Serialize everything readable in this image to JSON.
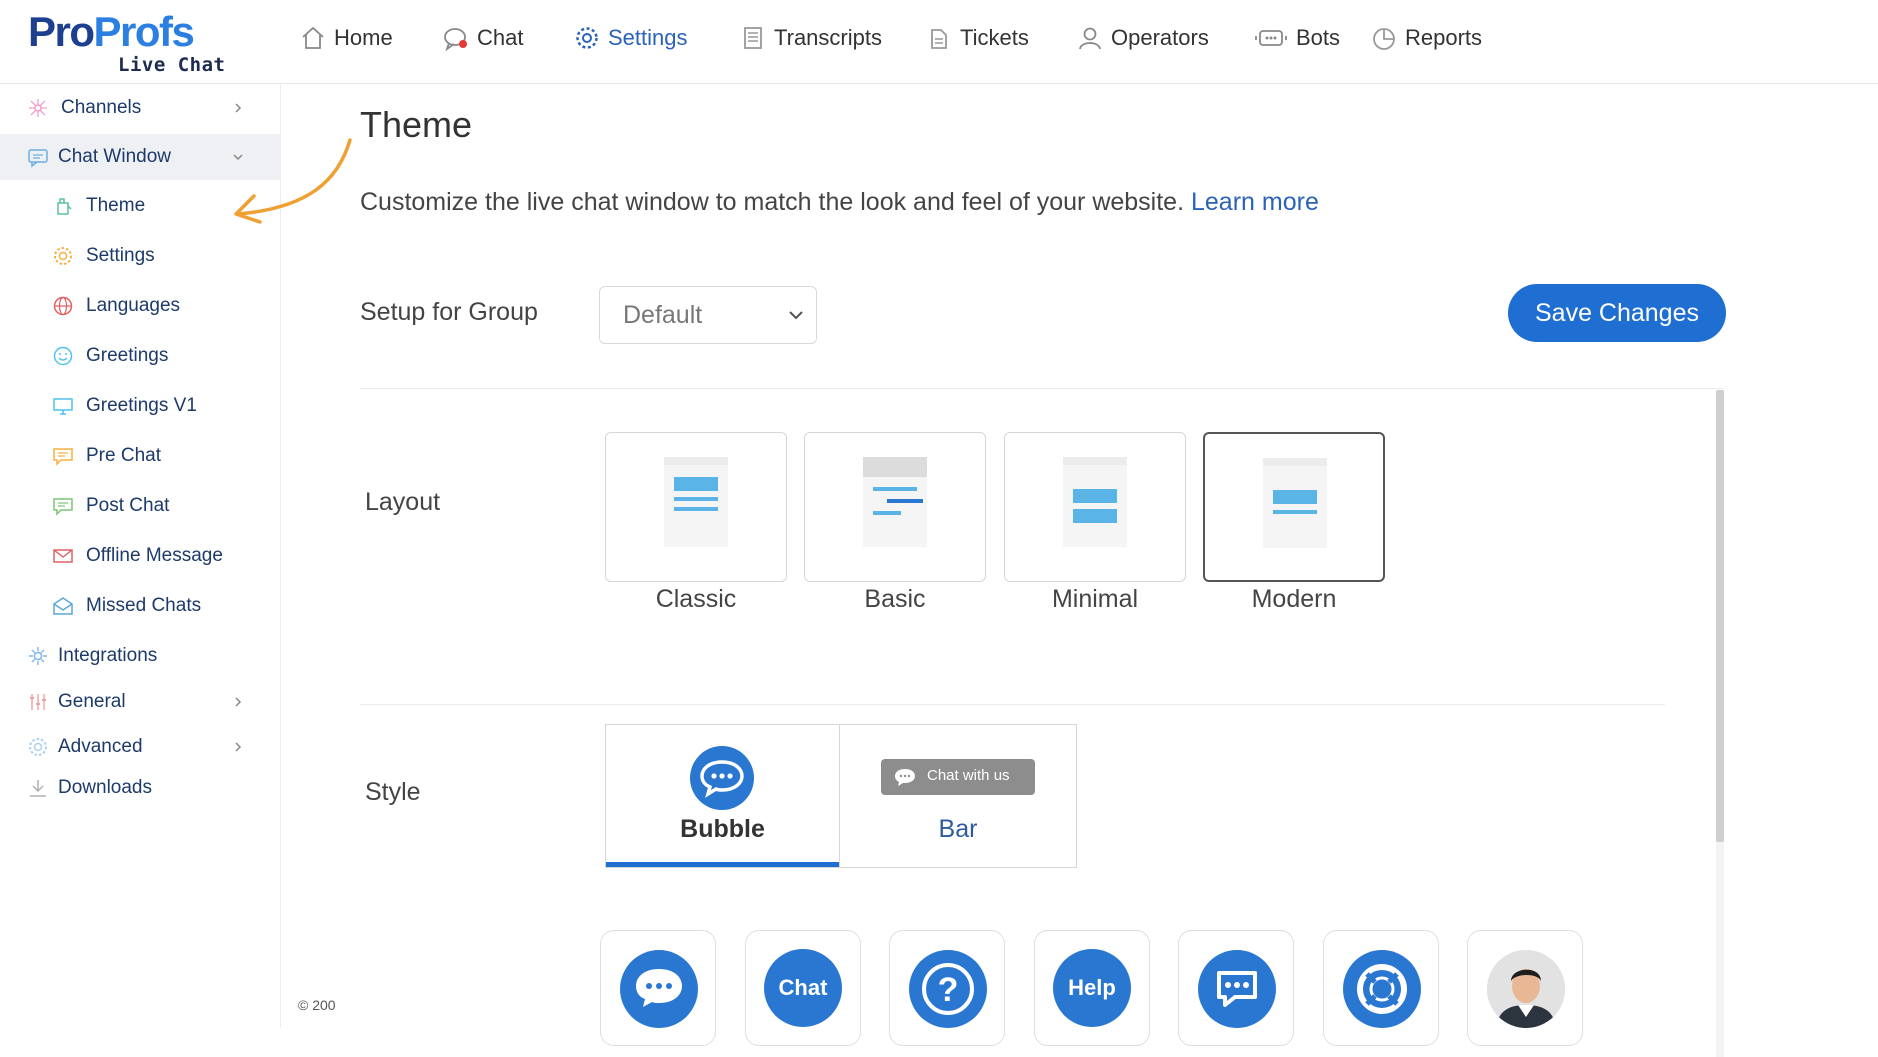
{
  "brand": {
    "name_part1": "Pro",
    "name_part2": "Profs",
    "product": "Live Chat"
  },
  "nav": [
    {
      "label": "Home",
      "icon": "home-icon"
    },
    {
      "label": "Chat",
      "icon": "chat-icon"
    },
    {
      "label": "Settings",
      "icon": "gear-icon"
    },
    {
      "label": "Transcripts",
      "icon": "document-icon"
    },
    {
      "label": "Tickets",
      "icon": "ticket-icon"
    },
    {
      "label": "Operators",
      "icon": "user-icon"
    },
    {
      "label": "Bots",
      "icon": "bot-icon"
    },
    {
      "label": "Reports",
      "icon": "pie-chart-icon"
    }
  ],
  "sidebar": {
    "items": [
      {
        "label": "Channels",
        "icon": "network-icon",
        "has_chevron": true
      },
      {
        "label": "Chat Window",
        "icon": "chat-window-icon",
        "has_chevron": true,
        "expanded": true
      },
      {
        "label": "Theme",
        "icon": "paint-bucket-icon"
      },
      {
        "label": "Settings",
        "icon": "gear-icon"
      },
      {
        "label": "Languages",
        "icon": "globe-icon"
      },
      {
        "label": "Greetings",
        "icon": "smiley-icon"
      },
      {
        "label": "Greetings V1",
        "icon": "monitor-icon"
      },
      {
        "label": "Pre Chat",
        "icon": "chat-bubble-icon"
      },
      {
        "label": "Post Chat",
        "icon": "chat-bubble-icon"
      },
      {
        "label": "Offline Message",
        "icon": "envelope-icon"
      },
      {
        "label": "Missed Chats",
        "icon": "open-envelope-icon"
      },
      {
        "label": "Integrations",
        "icon": "puzzle-icon"
      },
      {
        "label": "General",
        "icon": "sliders-icon",
        "has_chevron": true
      },
      {
        "label": "Advanced",
        "icon": "gear-icon",
        "has_chevron": true
      },
      {
        "label": "Downloads",
        "icon": "download-icon"
      }
    ],
    "copyright": "© 200"
  },
  "main": {
    "title": "Theme",
    "description": "Customize the live chat window to match the look and feel of your website.",
    "learn_more": "Learn more",
    "group_label": "Setup for Group",
    "group_value": "Default",
    "save_label": "Save Changes",
    "layout_label": "Layout",
    "layouts": [
      "Classic",
      "Basic",
      "Minimal",
      "Modern"
    ],
    "layout_selected": "Modern",
    "style_label": "Style",
    "styles": [
      "Bubble",
      "Bar"
    ],
    "style_selected": "Bubble",
    "bar_preview_text": "Chat with us",
    "bubble_icons": [
      {
        "icon": "chat-dots-icon"
      },
      {
        "icon": "chat-text-icon",
        "text": "Chat"
      },
      {
        "icon": "question-icon"
      },
      {
        "icon": "help-text-icon",
        "text": "Help"
      },
      {
        "icon": "chat-outline-icon"
      },
      {
        "icon": "lifebuoy-icon"
      },
      {
        "icon": "operator-avatar"
      }
    ]
  },
  "colors": {
    "accent": "#1f6ed1",
    "brand_dark": "#1d3f8f",
    "link": "#2a63b8",
    "annotation_arrow": "#f0a030"
  }
}
